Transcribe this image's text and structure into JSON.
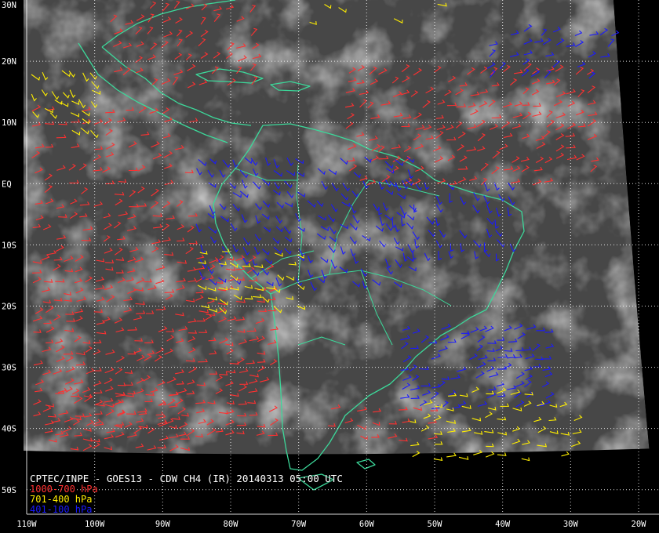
{
  "product_title": "CPTEC/INPE - GOES13 - CDW CH4 (IR) 20140313 05:00 UTC",
  "legend": [
    {
      "label": "1000-700 hPa",
      "color": "#ff3030"
    },
    {
      "label": "701-400 hPa",
      "color": "#ffee00"
    },
    {
      "label": "401-100 hPa",
      "color": "#1a1aff"
    }
  ],
  "colors": {
    "background": "#000000",
    "grid": "#ffffff",
    "coastline": "#3cd89a"
  },
  "latitude_labels": [
    {
      "label": "30N",
      "lat": 30
    },
    {
      "label": "20N",
      "lat": 20
    },
    {
      "label": "10N",
      "lat": 10
    },
    {
      "label": "EQ",
      "lat": 0
    },
    {
      "label": "10S",
      "lat": -10
    },
    {
      "label": "20S",
      "lat": -20
    },
    {
      "label": "30S",
      "lat": -30
    },
    {
      "label": "40S",
      "lat": -40
    },
    {
      "label": "50S",
      "lat": -50
    }
  ],
  "longitude_labels": [
    {
      "label": "110W",
      "lon": -110
    },
    {
      "label": "100W",
      "lon": -100
    },
    {
      "label": "90W",
      "lon": -90
    },
    {
      "label": "80W",
      "lon": -80
    },
    {
      "label": "70W",
      "lon": -70
    },
    {
      "label": "60W",
      "lon": -60
    },
    {
      "label": "50W",
      "lon": -50
    },
    {
      "label": "40W",
      "lon": -40
    },
    {
      "label": "30W",
      "lon": -30
    },
    {
      "label": "20W",
      "lon": -20
    }
  ],
  "extent": {
    "lon_min": -110,
    "lon_max": -17,
    "lat_min": -54,
    "lat_max": 30
  }
}
